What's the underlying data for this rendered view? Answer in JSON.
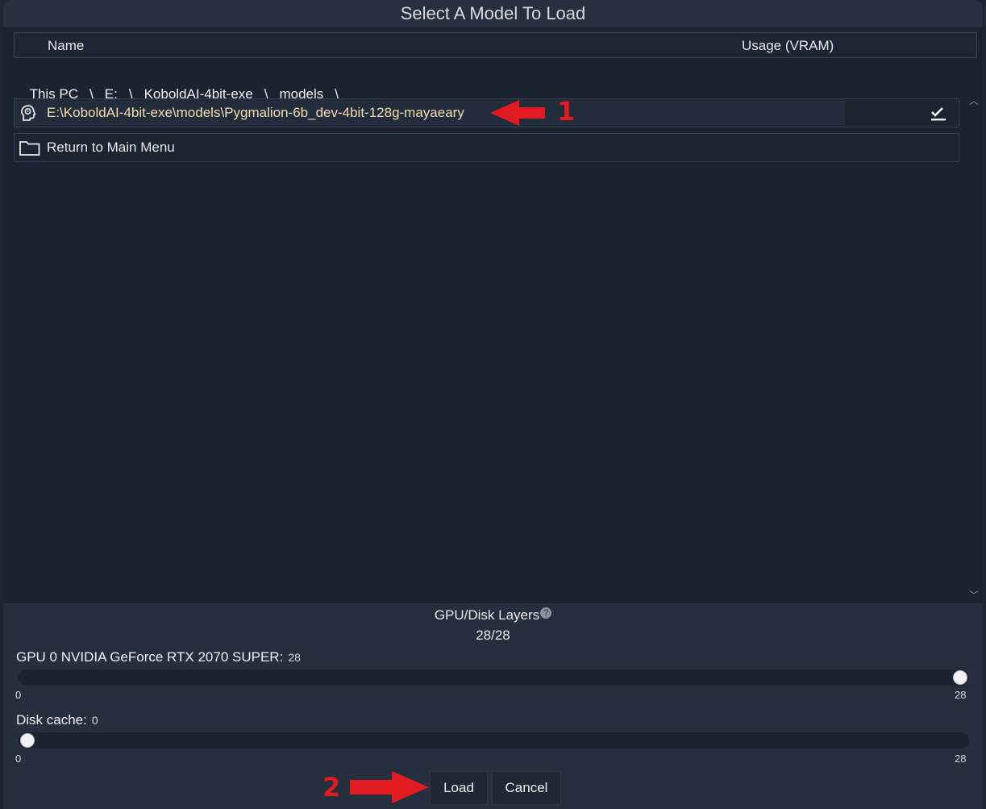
{
  "dialog": {
    "title": "Select A Model To Load",
    "columns": {
      "name": "Name",
      "usage": "Usage (VRAM)"
    },
    "breadcrumb": [
      "This PC",
      "\\",
      "E:",
      "\\",
      "KoboldAI-4bit-exe",
      "\\",
      "models",
      "\\"
    ],
    "rows": [
      {
        "label": "E:\\KoboldAI-4bit-exe\\models\\Pygmalion-6b_dev-4bit-128g-mayaeary",
        "icon": "brain-icon",
        "selected": true
      },
      {
        "label": "Return to Main Menu",
        "icon": "folder-icon",
        "selected": false
      }
    ]
  },
  "layers": {
    "title": "GPU/Disk Layers",
    "value": "28/28",
    "gpu_slider": {
      "label": "GPU 0 NVIDIA GeForce RTX 2070 SUPER:",
      "value": "28",
      "min": "0",
      "max": "28",
      "fraction": 1.0
    },
    "disk_slider": {
      "label": "Disk cache:",
      "value": "0",
      "min": "0",
      "max": "28",
      "fraction": 0.0
    }
  },
  "buttons": {
    "load": "Load",
    "cancel": "Cancel"
  },
  "annotations": {
    "first": "1",
    "second": "2"
  },
  "colors": {
    "annotation_red": "#e21b23",
    "accent_text": "#f2dcb0",
    "background": "#1b2330"
  }
}
